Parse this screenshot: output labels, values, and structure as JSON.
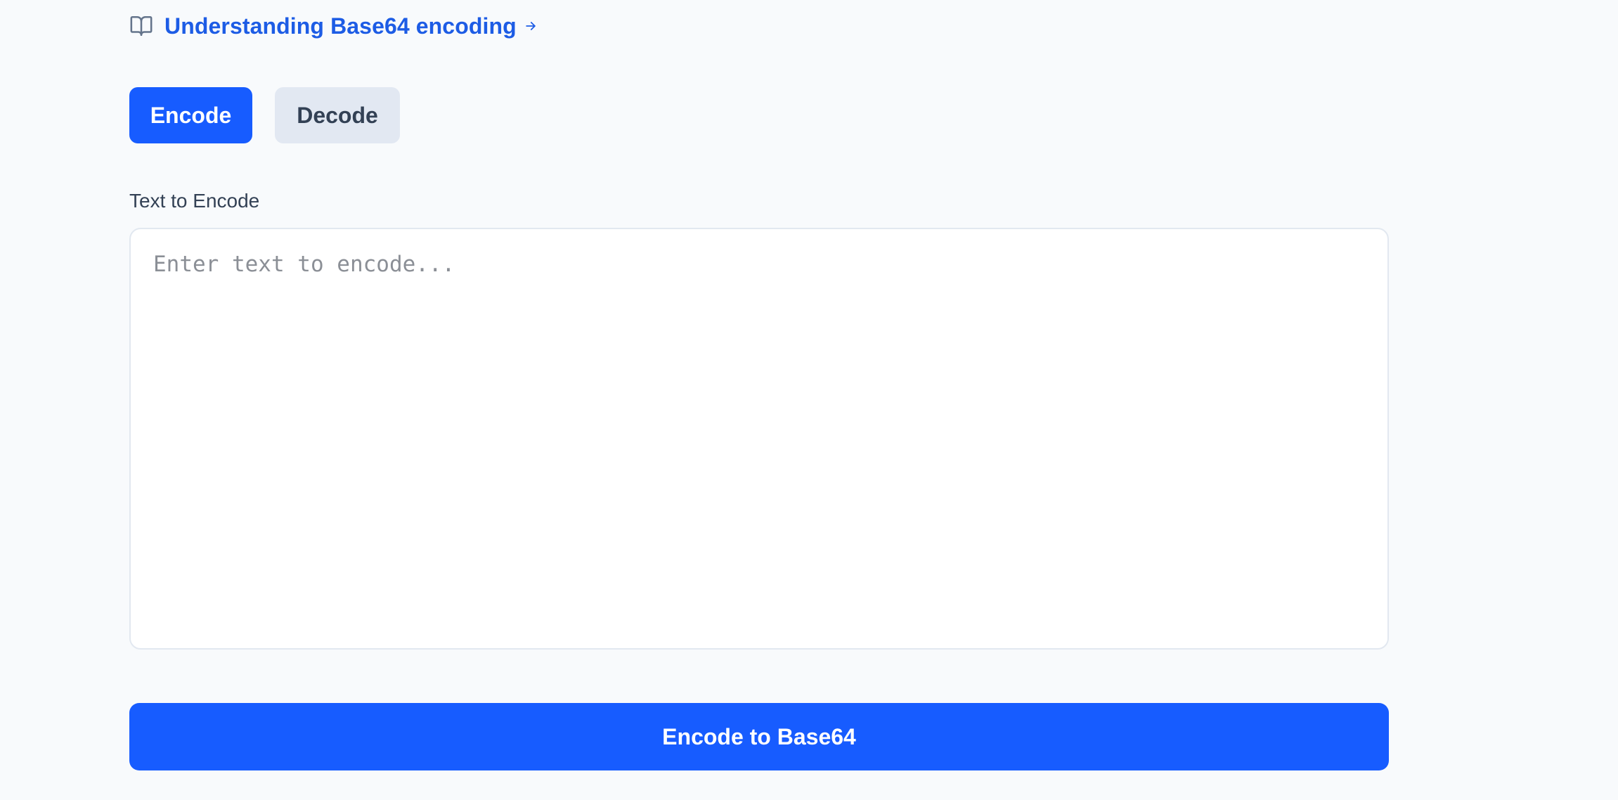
{
  "learn_link": {
    "text": "Understanding Base64 encoding",
    "icon": "book-open-icon",
    "trailing_icon": "arrow-right-icon",
    "color": "#1d5ce5"
  },
  "mode_toggle": {
    "encode_label": "Encode",
    "decode_label": "Decode",
    "active": "Encode",
    "active_color": "#175cff",
    "inactive_color": "#e2e8f2"
  },
  "input": {
    "label": "Text to Encode",
    "value": "",
    "placeholder": "Enter text to encode..."
  },
  "submit": {
    "label": "Encode to Base64",
    "color": "#175cff"
  }
}
